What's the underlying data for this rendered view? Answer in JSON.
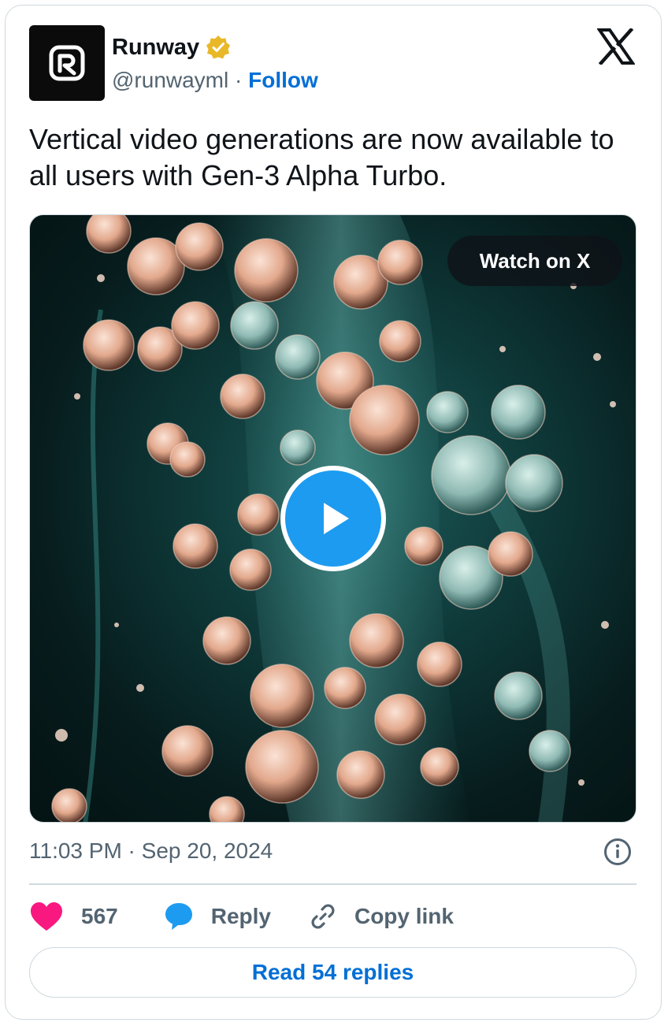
{
  "author": {
    "name": "Runway",
    "handle": "@runwayml",
    "separator": "·",
    "follow_label": "Follow",
    "verified_color": "#e8b829"
  },
  "tweet": {
    "text": "Vertical video generations are now available to all users with Gen-3 Alpha Turbo.",
    "timestamp": "11:03 PM · Sep 20, 2024"
  },
  "media": {
    "watch_label": "Watch on X",
    "play_icon": "play-icon",
    "play_color": "#1d9bf0"
  },
  "actions": {
    "like_count": "567",
    "reply_label": "Reply",
    "copy_label": "Copy link",
    "like_color": "#f91880",
    "reply_color": "#1d9bf0"
  },
  "footer": {
    "read_replies_label": "Read 54 replies"
  },
  "colors": {
    "link": "#006fd6",
    "muted": "#536471",
    "border": "#cfd9de"
  }
}
